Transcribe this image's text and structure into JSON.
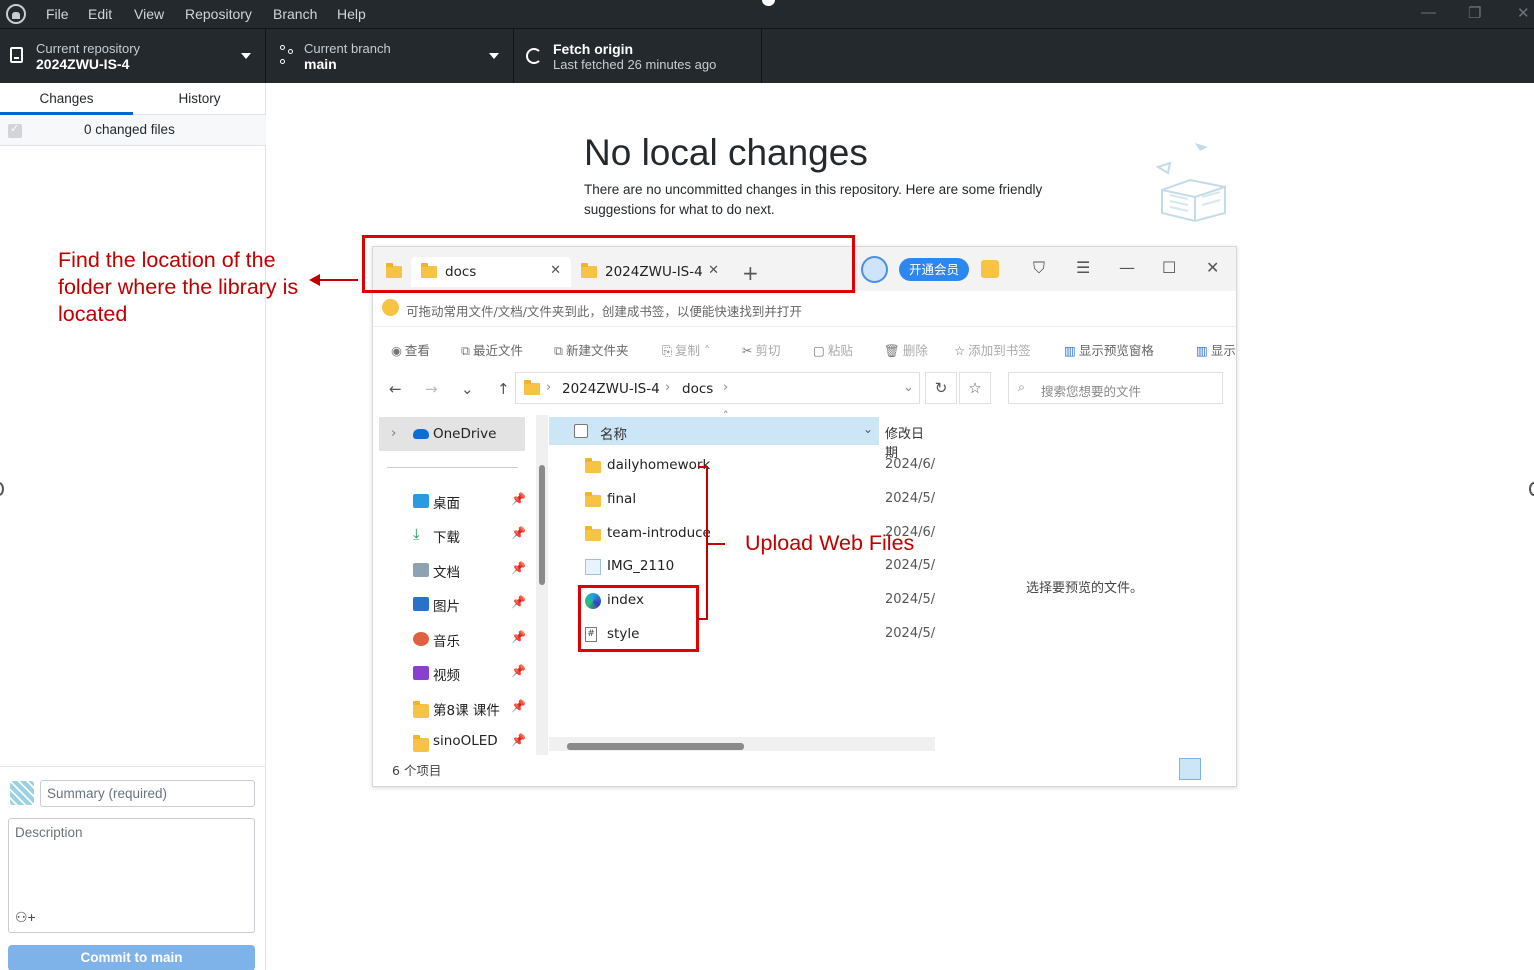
{
  "menu": [
    "File",
    "Edit",
    "View",
    "Repository",
    "Branch",
    "Help"
  ],
  "toolbar": {
    "repo_caption": "Current repository",
    "repo_name": "2024ZWU-IS-4",
    "branch_caption": "Current branch",
    "branch_name": "main",
    "fetch_title": "Fetch origin",
    "fetch_sub": "Last fetched 26 minutes ago"
  },
  "sidebar": {
    "tabs": [
      "Changes",
      "History"
    ],
    "changed_files": "0 changed files",
    "summary_placeholder": "Summary (required)",
    "description_placeholder": "Description",
    "commit_button": "Commit to main"
  },
  "main": {
    "title": "No local changes",
    "text": "There are no uncommitted changes in this repository. Here are some friendly suggestions for what to do next."
  },
  "annotations": {
    "left_note": "Find the location of the folder where the library is located",
    "upload_note": "Upload Web Files",
    "color": "#c00000"
  },
  "explorer": {
    "tabs": [
      "docs",
      "2024ZWU-IS-4"
    ],
    "vip_label": "开通会员",
    "hint": "可拖动常用文件/文档/文件夹到此，创建成书签，以便能快速找到并打开",
    "commands": [
      "查看",
      "最近文件",
      "新建文件夹",
      "复制",
      "剪切",
      "粘贴",
      "删除",
      "添加到书签",
      "显示预览窗格",
      "显示"
    ],
    "breadcrumb": [
      "2024ZWU-IS-4",
      "docs"
    ],
    "search_placeholder": "搜索您想要的文件",
    "nav": {
      "onedrive": "OneDrive",
      "items": [
        "桌面",
        "下载",
        "文档",
        "图片",
        "音乐",
        "视频",
        "第8课 课件",
        "sinoOLED"
      ]
    },
    "columns": {
      "name": "名称",
      "date": "修改日期"
    },
    "files": [
      {
        "name": "dailyhomework",
        "date": "2024/6/",
        "type": "folder"
      },
      {
        "name": "final",
        "date": "2024/5/",
        "type": "folder"
      },
      {
        "name": "team-introduce",
        "date": "2024/6/",
        "type": "folder"
      },
      {
        "name": "IMG_2110",
        "date": "2024/5/",
        "type": "image"
      },
      {
        "name": "index",
        "date": "2024/5/",
        "type": "edge-html"
      },
      {
        "name": "style",
        "date": "2024/5/",
        "type": "css"
      }
    ],
    "preview_text": "选择要预览的文件。",
    "status": "6 个项目"
  }
}
